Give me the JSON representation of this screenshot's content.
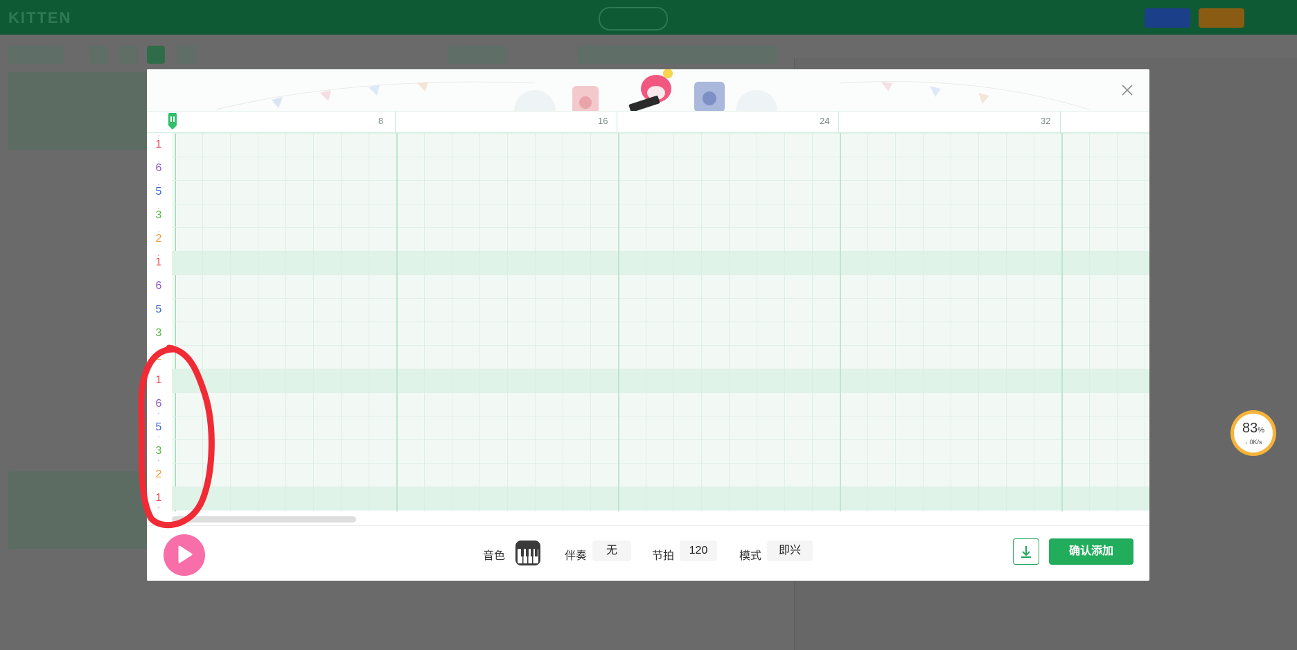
{
  "ruler": {
    "marks": [
      "8",
      "16",
      "24",
      "32"
    ]
  },
  "keys": [
    {
      "label": "1",
      "color": "#e0424e",
      "octave": "double-high"
    },
    {
      "label": "6",
      "color": "#8a55c2",
      "octave": "high"
    },
    {
      "label": "5",
      "color": "#3a63c9",
      "octave": "high"
    },
    {
      "label": "3",
      "color": "#5ab548",
      "octave": "high"
    },
    {
      "label": "2",
      "color": "#f29a3a",
      "octave": "high"
    },
    {
      "label": "1",
      "color": "#e0424e",
      "octave": "high"
    },
    {
      "label": "6",
      "color": "#8a55c2",
      "octave": "mid"
    },
    {
      "label": "5",
      "color": "#3a63c9",
      "octave": "mid"
    },
    {
      "label": "3",
      "color": "#5ab548",
      "octave": "mid"
    },
    {
      "label": "2",
      "color": "#f29a3a",
      "octave": "mid"
    },
    {
      "label": "1",
      "color": "#e0424e",
      "octave": "mid"
    },
    {
      "label": "6",
      "color": "#8a55c2",
      "octave": "low"
    },
    {
      "label": "5",
      "color": "#3a63c9",
      "octave": "low"
    },
    {
      "label": "3",
      "color": "#5ab548",
      "octave": "low"
    },
    {
      "label": "2",
      "color": "#f29a3a",
      "octave": "low"
    },
    {
      "label": "1",
      "color": "#e0424e",
      "octave": "low"
    }
  ],
  "footer": {
    "timbre_label": "音色",
    "accompaniment_label": "伴奏",
    "accompaniment_value": "无",
    "tempo_label": "节拍",
    "tempo_value": "120",
    "mode_label": "模式",
    "mode_value": "即兴",
    "confirm_label": "确认添加"
  },
  "speed_widget": {
    "percent": "83",
    "unit": "%",
    "rate": "0K/s"
  },
  "colors": {
    "accent_green": "#22ad5c",
    "play_pink": "#f76ea9",
    "annotation_red": "#f02b35"
  }
}
